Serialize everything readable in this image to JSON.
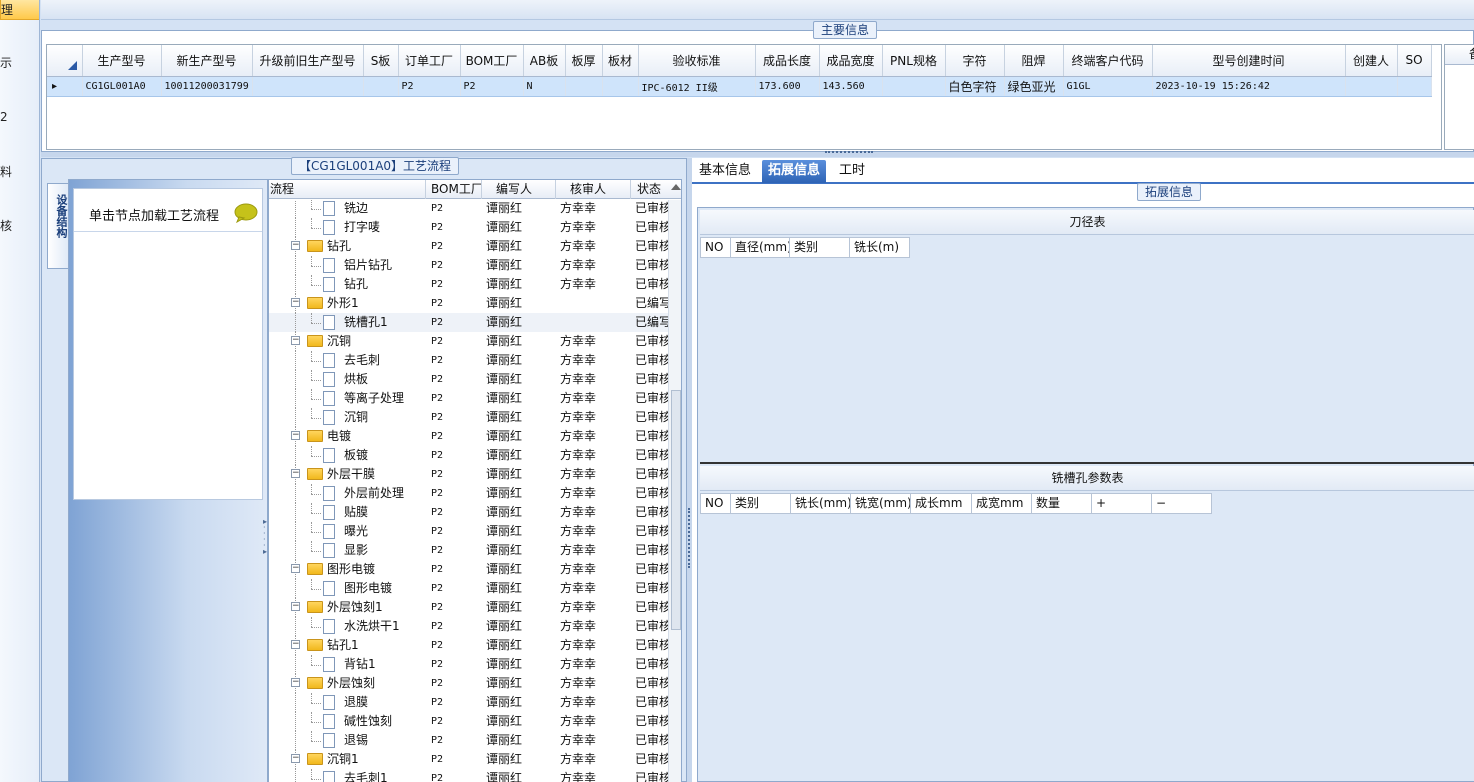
{
  "left_nav": {
    "items": [
      {
        "label": "理",
        "active": true
      },
      {
        "label": "示"
      },
      {
        "label": "2"
      },
      {
        "label": "料"
      },
      {
        "label": "核"
      }
    ]
  },
  "main_info": {
    "caption": "主要信息",
    "columns": [
      "生产型号",
      "新生产型号",
      "升级前旧生产型号",
      "S板",
      "订单工厂",
      "BOM工厂",
      "AB板",
      "板厚",
      "板材",
      "验收标准",
      "成品长度",
      "成品宽度",
      "PNL规格",
      "字符",
      "阻焊",
      "终端客户代码",
      "型号创建时间",
      "创建人",
      "SO"
    ],
    "row": {
      "marker": "▸",
      "cells": [
        "CG1GL001A0",
        "10011200031799",
        "",
        "",
        "P2",
        "P2",
        "N",
        "",
        "",
        "IPC-6012 II级",
        "173.600",
        "143.560",
        "",
        "白色字符",
        "绿色亚光",
        "G1GL",
        "2023-10-19 15:26:42",
        "",
        ""
      ]
    },
    "side_header": "备"
  },
  "process": {
    "caption": "【CG1GL001A0】工艺流程",
    "side_tab": "设备结构",
    "hint": "单击节点加载工艺流程",
    "columns": [
      "流程",
      "BOM工厂",
      "编写人",
      "核审人",
      "状态"
    ],
    "rows": [
      {
        "type": "file",
        "level": 2,
        "name": "铣边",
        "bom": "P2",
        "writer": "谭丽红",
        "reviewer": "方幸幸",
        "status": "已审核"
      },
      {
        "type": "file",
        "level": 2,
        "name": "打字唛",
        "bom": "P2",
        "writer": "谭丽红",
        "reviewer": "方幸幸",
        "status": "已审核"
      },
      {
        "type": "folder",
        "level": 1,
        "name": "钻孔",
        "bom": "P2",
        "writer": "谭丽红",
        "reviewer": "方幸幸",
        "status": "已审核"
      },
      {
        "type": "file",
        "level": 2,
        "name": "铝片钻孔",
        "bom": "P2",
        "writer": "谭丽红",
        "reviewer": "方幸幸",
        "status": "已审核"
      },
      {
        "type": "file",
        "level": 2,
        "name": "钻孔",
        "bom": "P2",
        "writer": "谭丽红",
        "reviewer": "方幸幸",
        "status": "已审核"
      },
      {
        "type": "folder",
        "level": 1,
        "name": "外形1",
        "bom": "P2",
        "writer": "谭丽红",
        "reviewer": "",
        "status": "已编写"
      },
      {
        "type": "file",
        "level": 2,
        "name": "铣槽孔1",
        "bom": "P2",
        "writer": "谭丽红",
        "reviewer": "",
        "status": "已编写",
        "selected": true
      },
      {
        "type": "folder",
        "level": 1,
        "name": "沉铜",
        "bom": "P2",
        "writer": "谭丽红",
        "reviewer": "方幸幸",
        "status": "已审核"
      },
      {
        "type": "file",
        "level": 2,
        "name": "去毛刺",
        "bom": "P2",
        "writer": "谭丽红",
        "reviewer": "方幸幸",
        "status": "已审核"
      },
      {
        "type": "file",
        "level": 2,
        "name": "烘板",
        "bom": "P2",
        "writer": "谭丽红",
        "reviewer": "方幸幸",
        "status": "已审核"
      },
      {
        "type": "file",
        "level": 2,
        "name": "等离子处理",
        "bom": "P2",
        "writer": "谭丽红",
        "reviewer": "方幸幸",
        "status": "已审核"
      },
      {
        "type": "file",
        "level": 2,
        "name": "沉铜",
        "bom": "P2",
        "writer": "谭丽红",
        "reviewer": "方幸幸",
        "status": "已审核"
      },
      {
        "type": "folder",
        "level": 1,
        "name": "电镀",
        "bom": "P2",
        "writer": "谭丽红",
        "reviewer": "方幸幸",
        "status": "已审核"
      },
      {
        "type": "file",
        "level": 2,
        "name": "板镀",
        "bom": "P2",
        "writer": "谭丽红",
        "reviewer": "方幸幸",
        "status": "已审核"
      },
      {
        "type": "folder",
        "level": 1,
        "name": "外层干膜",
        "bom": "P2",
        "writer": "谭丽红",
        "reviewer": "方幸幸",
        "status": "已审核"
      },
      {
        "type": "file",
        "level": 2,
        "name": "外层前处理",
        "bom": "P2",
        "writer": "谭丽红",
        "reviewer": "方幸幸",
        "status": "已审核"
      },
      {
        "type": "file",
        "level": 2,
        "name": "贴膜",
        "bom": "P2",
        "writer": "谭丽红",
        "reviewer": "方幸幸",
        "status": "已审核"
      },
      {
        "type": "file",
        "level": 2,
        "name": "曝光",
        "bom": "P2",
        "writer": "谭丽红",
        "reviewer": "方幸幸",
        "status": "已审核"
      },
      {
        "type": "file",
        "level": 2,
        "name": "显影",
        "bom": "P2",
        "writer": "谭丽红",
        "reviewer": "方幸幸",
        "status": "已审核"
      },
      {
        "type": "folder",
        "level": 1,
        "name": "图形电镀",
        "bom": "P2",
        "writer": "谭丽红",
        "reviewer": "方幸幸",
        "status": "已审核"
      },
      {
        "type": "file",
        "level": 2,
        "name": "图形电镀",
        "bom": "P2",
        "writer": "谭丽红",
        "reviewer": "方幸幸",
        "status": "已审核"
      },
      {
        "type": "folder",
        "level": 1,
        "name": "外层蚀刻1",
        "bom": "P2",
        "writer": "谭丽红",
        "reviewer": "方幸幸",
        "status": "已审核"
      },
      {
        "type": "file",
        "level": 2,
        "name": "水洗烘干1",
        "bom": "P2",
        "writer": "谭丽红",
        "reviewer": "方幸幸",
        "status": "已审核"
      },
      {
        "type": "folder",
        "level": 1,
        "name": "钻孔1",
        "bom": "P2",
        "writer": "谭丽红",
        "reviewer": "方幸幸",
        "status": "已审核"
      },
      {
        "type": "file",
        "level": 2,
        "name": "背钻1",
        "bom": "P2",
        "writer": "谭丽红",
        "reviewer": "方幸幸",
        "status": "已审核"
      },
      {
        "type": "folder",
        "level": 1,
        "name": "外层蚀刻",
        "bom": "P2",
        "writer": "谭丽红",
        "reviewer": "方幸幸",
        "status": "已审核"
      },
      {
        "type": "file",
        "level": 2,
        "name": "退膜",
        "bom": "P2",
        "writer": "谭丽红",
        "reviewer": "方幸幸",
        "status": "已审核"
      },
      {
        "type": "file",
        "level": 2,
        "name": "碱性蚀刻",
        "bom": "P2",
        "writer": "谭丽红",
        "reviewer": "方幸幸",
        "status": "已审核"
      },
      {
        "type": "file",
        "level": 2,
        "name": "退锡",
        "bom": "P2",
        "writer": "谭丽红",
        "reviewer": "方幸幸",
        "status": "已审核"
      },
      {
        "type": "folder",
        "level": 1,
        "name": "沉铜1",
        "bom": "P2",
        "writer": "谭丽红",
        "reviewer": "方幸幸",
        "status": "已审核"
      },
      {
        "type": "file",
        "level": 2,
        "name": "去毛刺1",
        "bom": "P2",
        "writer": "谭丽红",
        "reviewer": "方幸幸",
        "status": "已审核"
      }
    ]
  },
  "detail": {
    "tabs": [
      "基本信息",
      "拓展信息",
      "工时"
    ],
    "active_tab": 1,
    "group_caption": "拓展信息",
    "tool_table": {
      "title": "刀径表",
      "columns": [
        "NO",
        "直径(mm)",
        "类别",
        "铣长(m)"
      ]
    },
    "slot_table": {
      "title": "铣槽孔参数表",
      "columns": [
        "NO",
        "类别",
        "铣长(mm)",
        "铣宽(mm)",
        "成长mm",
        "成宽mm",
        "数量",
        "+",
        "−"
      ]
    }
  }
}
